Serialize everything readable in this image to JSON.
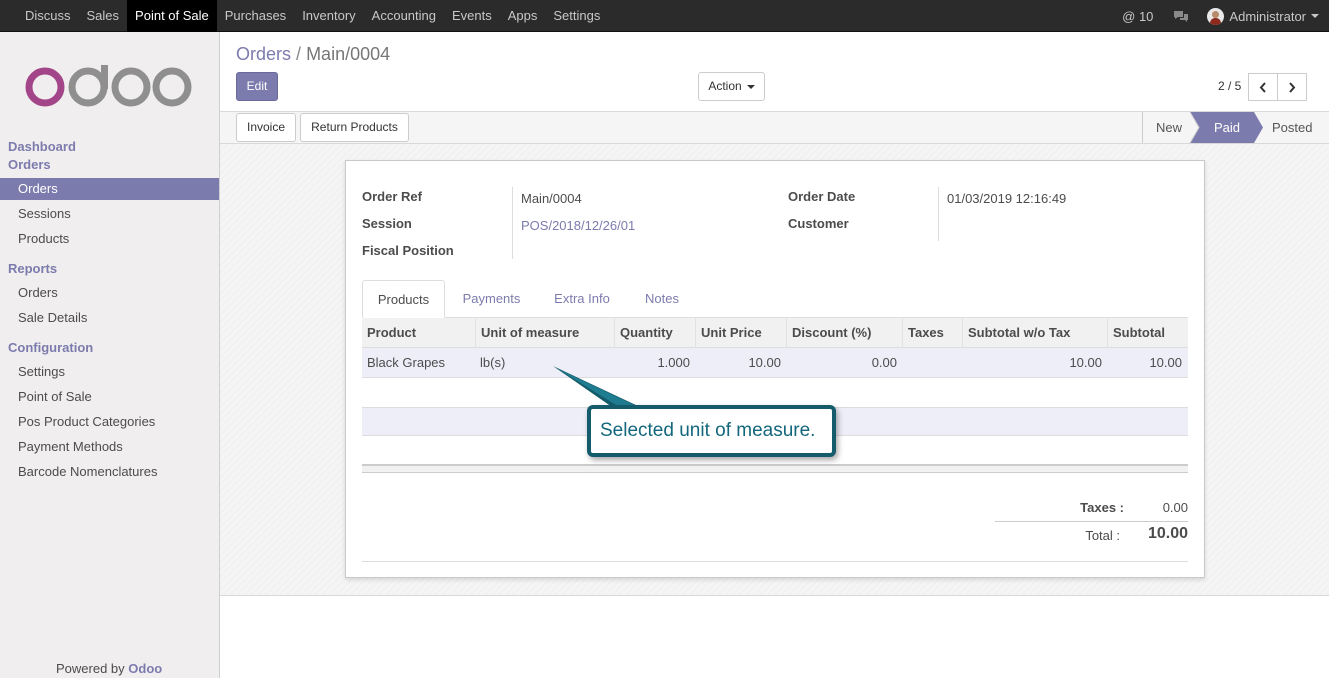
{
  "topbar": {
    "menu": [
      "Discuss",
      "Sales",
      "Point of Sale",
      "Purchases",
      "Inventory",
      "Accounting",
      "Events",
      "Apps",
      "Settings"
    ],
    "active": "Point of Sale",
    "mentions": "@ 10",
    "user": "Administrator"
  },
  "sidebar": {
    "dashboard": "Dashboard",
    "orders_section": "Orders",
    "orders_items": [
      "Orders",
      "Sessions",
      "Products"
    ],
    "reports_section": "Reports",
    "reports_items": [
      "Orders",
      "Sale Details"
    ],
    "config_section": "Configuration",
    "config_items": [
      "Settings",
      "Point of Sale",
      "Pos Product Categories",
      "Payment Methods",
      "Barcode Nomenclatures"
    ],
    "powered_prefix": "Powered by",
    "powered_brand": "Odoo"
  },
  "breadcrumb": {
    "parent": "Orders",
    "separator": "/",
    "current": "Main/0004"
  },
  "buttons": {
    "edit": "Edit",
    "action": "Action",
    "invoice": "Invoice",
    "return_products": "Return Products"
  },
  "pager": {
    "text": "2 / 5"
  },
  "stages": {
    "new": "New",
    "paid": "Paid",
    "posted": "Posted",
    "current": "Paid"
  },
  "form": {
    "order_ref_label": "Order Ref",
    "order_ref": "Main/0004",
    "session_label": "Session",
    "session": "POS/2018/12/26/01",
    "fiscal_label": "Fiscal Position",
    "order_date_label": "Order Date",
    "order_date": "01/03/2019 12:16:49",
    "customer_label": "Customer"
  },
  "tabs": [
    "Products",
    "Payments",
    "Extra Info",
    "Notes"
  ],
  "table": {
    "headers": [
      "Product",
      "Unit of measure",
      "Quantity",
      "Unit Price",
      "Discount (%)",
      "Taxes",
      "Subtotal w/o Tax",
      "Subtotal"
    ],
    "row": {
      "product": "Black Grapes",
      "uom": "lb(s)",
      "quantity": "1.000",
      "unit_price": "10.00",
      "discount": "0.00",
      "taxes": "",
      "subtotal_wo_tax": "10.00",
      "subtotal": "10.00"
    }
  },
  "totals": {
    "taxes_label": "Taxes :",
    "taxes": "0.00",
    "total_label": "Total :",
    "total": "10.00"
  },
  "callout": {
    "text": "Selected unit of measure."
  },
  "colors": {
    "brand": "#7c7bad",
    "callout_border": "#145b6b",
    "callout_text": "#13677d"
  }
}
